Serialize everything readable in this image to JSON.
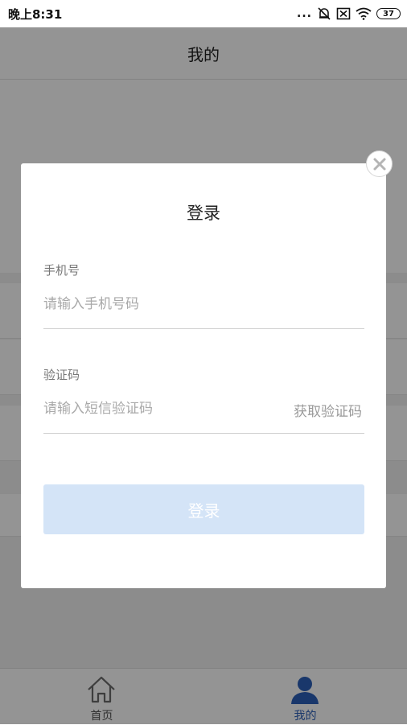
{
  "status_bar": {
    "time": "晚上8:31",
    "dots": "...",
    "battery": "37"
  },
  "header": {
    "title": "我的"
  },
  "tabbar": {
    "home_label": "首页",
    "mine_label": "我的"
  },
  "modal": {
    "title": "登录",
    "phone_label": "手机号",
    "phone_placeholder": "请输入手机号码",
    "code_label": "验证码",
    "code_placeholder": "请输入短信验证码",
    "get_code_label": "获取验证码",
    "login_label": "登录"
  },
  "colors": {
    "accent": "#2c5fb8",
    "login_button_disabled": "#d4e4f7"
  },
  "icons": {
    "close": "close-icon",
    "home": "home-icon",
    "mine": "user-icon"
  }
}
